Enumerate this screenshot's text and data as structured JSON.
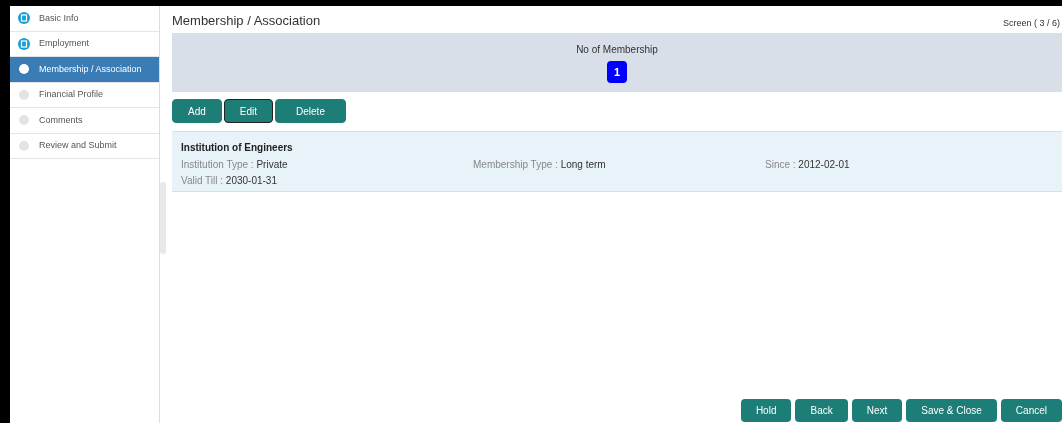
{
  "steps": [
    {
      "label": "Basic Info",
      "completed": true,
      "selected": false
    },
    {
      "label": "Employment",
      "completed": true,
      "selected": false
    },
    {
      "label": "Membership / Association",
      "completed": false,
      "selected": true
    },
    {
      "label": "Financial Profile",
      "completed": false,
      "selected": false
    },
    {
      "label": "Comments",
      "completed": false,
      "selected": false
    },
    {
      "label": "Review and Submit",
      "completed": false,
      "selected": false
    }
  ],
  "title": "Membership / Association",
  "screen_counter": "Screen ( 3 / 6)",
  "summary": {
    "label": "No of Membership",
    "count": "1"
  },
  "actions": [
    {
      "label": "Add",
      "focused": false
    },
    {
      "label": "Edit",
      "focused": true
    },
    {
      "label": "Delete",
      "focused": false
    }
  ],
  "records": [
    {
      "name": "Institution of Engineers",
      "fields": [
        {
          "label": "Institution Type :",
          "value": "Private"
        },
        {
          "label": "Membership Type :",
          "value": "Long term"
        },
        {
          "label": "Since :",
          "value": "2012-02-01"
        },
        {
          "label": "Valid Till :",
          "value": "2030-01-31"
        }
      ]
    }
  ],
  "footer_buttons": [
    "Hold",
    "Back",
    "Next",
    "Save & Close",
    "Cancel"
  ]
}
